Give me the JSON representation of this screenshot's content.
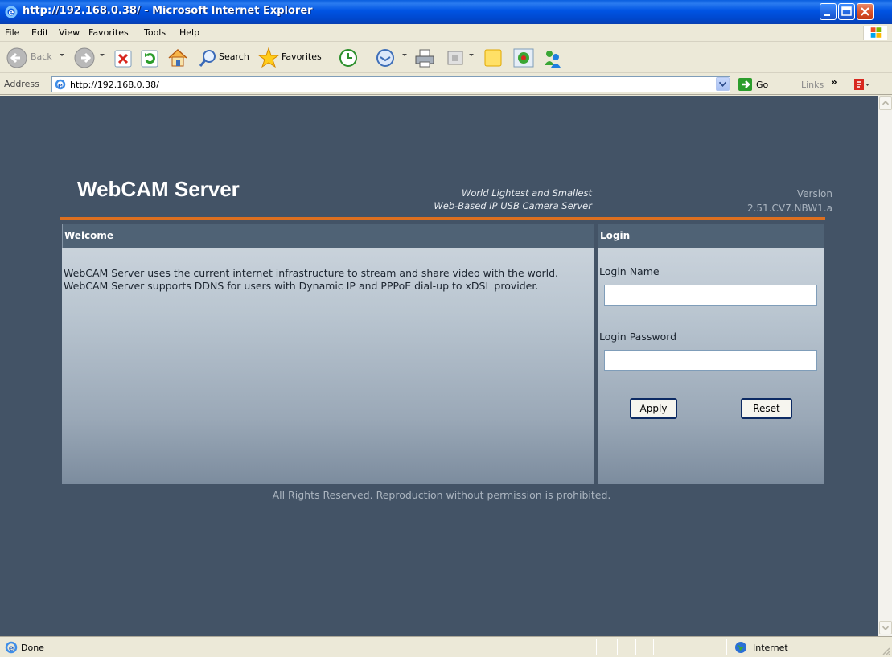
{
  "window": {
    "title": "http://192.168.0.38/ - Microsoft Internet Explorer",
    "icon": "ie-icon"
  },
  "menu": {
    "items": [
      {
        "label": "File",
        "accel": "F"
      },
      {
        "label": "Edit",
        "accel": "E"
      },
      {
        "label": "View",
        "accel": "V"
      },
      {
        "label": "Favorites",
        "accel": "a"
      },
      {
        "label": "Tools",
        "accel": "T"
      },
      {
        "label": "Help",
        "accel": "H"
      }
    ]
  },
  "toolbar": {
    "back_label": "Back",
    "search_label": "Search",
    "favorites_label": "Favorites"
  },
  "address": {
    "label": "Address",
    "url": "http://192.168.0.38/",
    "go_label": "Go",
    "links_label": "Links"
  },
  "page": {
    "brand": "WebCAM Server",
    "tagline_1": "World Lightest and Smallest",
    "tagline_2": "Web-Based IP USB Camera Server",
    "version_label": "Version",
    "version_value": "2.51.CV7.NBW1.a",
    "accent_color": "#dd6f1f",
    "background_color": "#435366",
    "welcome": {
      "title": "Welcome",
      "lines": [
        "WebCAM Server uses the current internet infrastructure to stream and share video with the world.",
        "WebCAM Server supports DDNS for users with Dynamic IP and PPPoE dial-up to xDSL provider."
      ]
    },
    "login": {
      "title": "Login",
      "name_label": "Login Name",
      "name_value": "",
      "password_label": "Login Password",
      "password_value": "",
      "apply_label": "Apply",
      "reset_label": "Reset"
    },
    "footer": "All Rights Reserved. Reproduction without permission is prohibited."
  },
  "status": {
    "text": "Done",
    "zone": "Internet"
  }
}
